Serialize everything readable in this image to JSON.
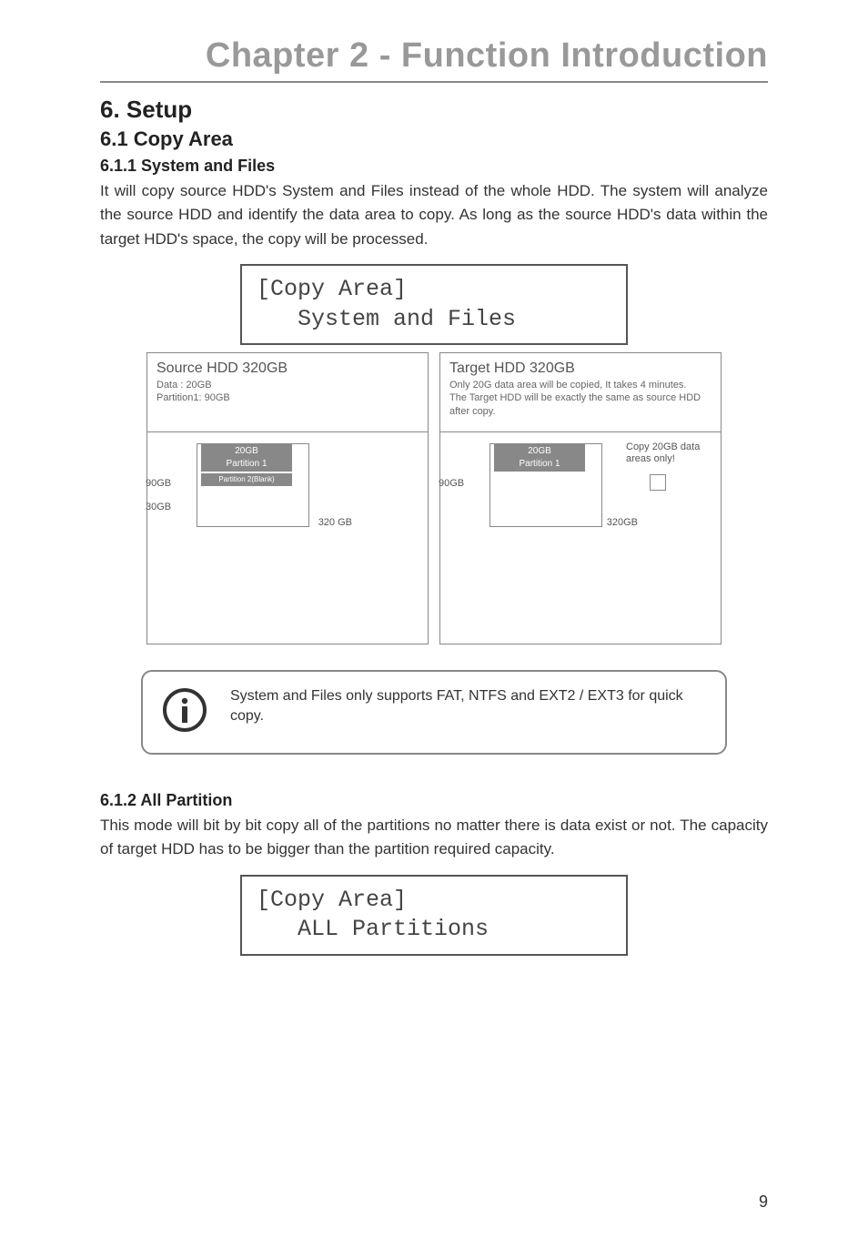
{
  "chapter_title": "Chapter 2 - Function Introduction",
  "section_h1": "6.  Setup",
  "section_h2": "6.1 Copy Area",
  "section_h3_1": "6.1.1 System and Files",
  "body_1": "It will copy source HDD's System and Files instead of the whole HDD. The system will analyze the source HDD and identify the data area to copy. As long as the source HDD's data within the target HDD's space, the copy will be processed.",
  "lcd1": {
    "line1": "[Copy Area]",
    "line2": "System and Files"
  },
  "diagram": {
    "source": {
      "title": "Source HDD 320GB",
      "sub1": "Data : 20GB",
      "sub2": "Partition1: 90GB",
      "p1_top": "20GB",
      "p1_name": "Partition 1",
      "p2_name": "Partition 2(Blank)",
      "left_label_1": "90GB",
      "left_label_2": "30GB",
      "total": "320 GB"
    },
    "target": {
      "title": "Target HDD 320GB",
      "sub1": "Only 20G data area will be copied, It takes 4 minutes.",
      "sub2": "The Target HDD will be exactly the same as source HDD after copy.",
      "p1_top": "20GB",
      "p1_name": "Partition 1",
      "left_label_1": "90GB",
      "total": "320GB",
      "callout": "Copy 20GB data areas   only!"
    }
  },
  "info_note": "System and Files only supports FAT, NTFS and EXT2 / EXT3 for quick copy.",
  "section_h3_2": "6.1.2 All Partition",
  "body_2": "This mode will bit by bit copy all of the partitions no matter there is data exist or not. The capacity of target HDD has to be bigger than the partition required capacity.",
  "lcd2": {
    "line1": "[Copy Area]",
    "line2": "ALL Partitions"
  },
  "page_number": "9"
}
